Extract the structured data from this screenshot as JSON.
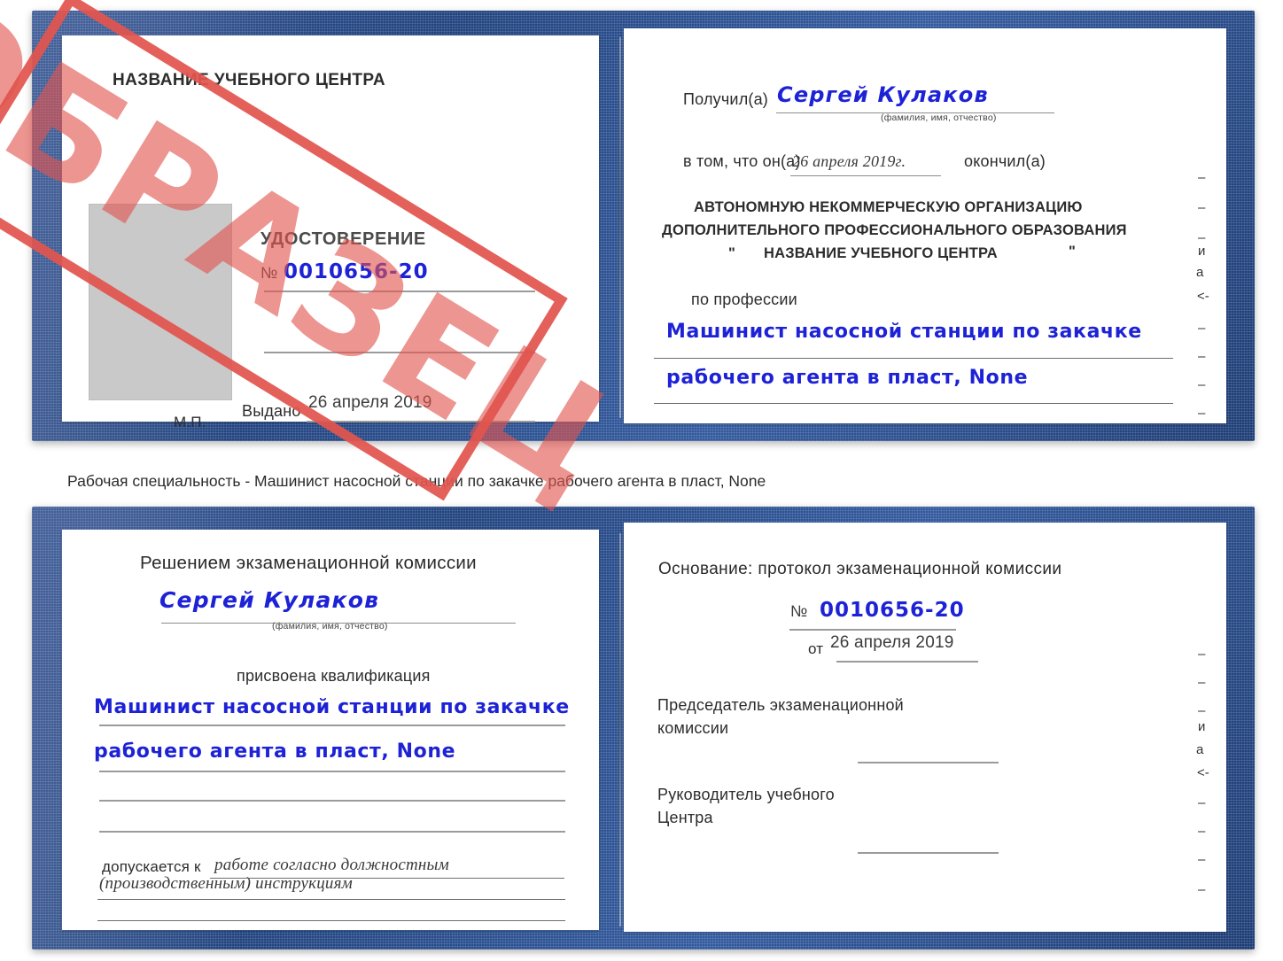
{
  "document": {
    "type": "Удостоверение",
    "caption": "Рабочая специальность - Машинист насосной станции по закачке рабочего агента в пласт, None",
    "watermark": "ОБРАЗЕЦ",
    "colors": {
      "cover": "#2d4f91",
      "handwriting": "#1d22d6",
      "stamp": "#e2554f",
      "photo_placeholder": "#c9c9c9",
      "rule": "#9b9b9b"
    }
  },
  "certificate_1": {
    "left_page": {
      "center_name": "НАЗВАНИЕ УЧЕБНОГО ЦЕНТРА",
      "title": "УДОСТОВЕРЕНИЕ",
      "number_symbol": "№",
      "number_value": "0010656-20",
      "issued_label": "Выдано",
      "issued_value": "26 апреля 2019",
      "seal_label": "М.П.",
      "photo_placeholder": "photo-placeholder"
    },
    "right_page": {
      "received_label": "Получил(а)",
      "received_value": "Сергей Кулаков",
      "received_hint": "(фамилия, имя, отчество)",
      "that_he_label": "в том, что он(а)",
      "that_he_date": "26 апреля 2019г.",
      "finished_label": "окончил(а)",
      "org_line1": "АВТОНОМНУЮ НЕКОММЕРЧЕСКУЮ ОРГАНИЗАЦИЮ",
      "org_line2": "ДОПОЛНИТЕЛЬНОГО ПРОФЕССИОНАЛЬНОГО ОБРАЗОВАНИЯ",
      "org_quote_open": "\"",
      "org_line3": "НАЗВАНИЕ УЧЕБНОГО ЦЕНТРА",
      "org_quote_close": "\"",
      "profession_label": "по профессии",
      "profession_line1": "Машинист насосной станции по закачке",
      "profession_line2": "рабочего агента в пласт, None",
      "edge_fragments": [
        "–",
        "–",
        "–",
        "и",
        "а",
        "<-",
        "–",
        "–",
        "–",
        "–"
      ]
    }
  },
  "certificate_2": {
    "left_page": {
      "heading": "Решением экзаменационной комиссии",
      "name_value": "Сергей Кулаков",
      "name_hint": "(фамилия, имя, отчество)",
      "qualification_label": "присвоена квалификация",
      "qualification_line1": "Машинист насосной станции по закачке",
      "qualification_line2": "рабочего агента в пласт, None",
      "allowed_label": "допускается к",
      "allowed_value_line1": "работе согласно должностным",
      "allowed_value_line2": "(производственным) инструкциям"
    },
    "right_page": {
      "basis_label": "Основание: протокол экзаменационной комиссии",
      "number_symbol": "№",
      "number_value": "0010656-20",
      "date_label": "от",
      "date_value": "26 апреля 2019",
      "chairman_line1": "Председатель экзаменационной",
      "chairman_line2": "комиссии",
      "head_line1": "Руководитель учебного",
      "head_line2": "Центра",
      "edge_fragments": [
        "–",
        "–",
        "–",
        "и",
        "а",
        "<-",
        "–",
        "–",
        "–",
        "–"
      ]
    }
  }
}
